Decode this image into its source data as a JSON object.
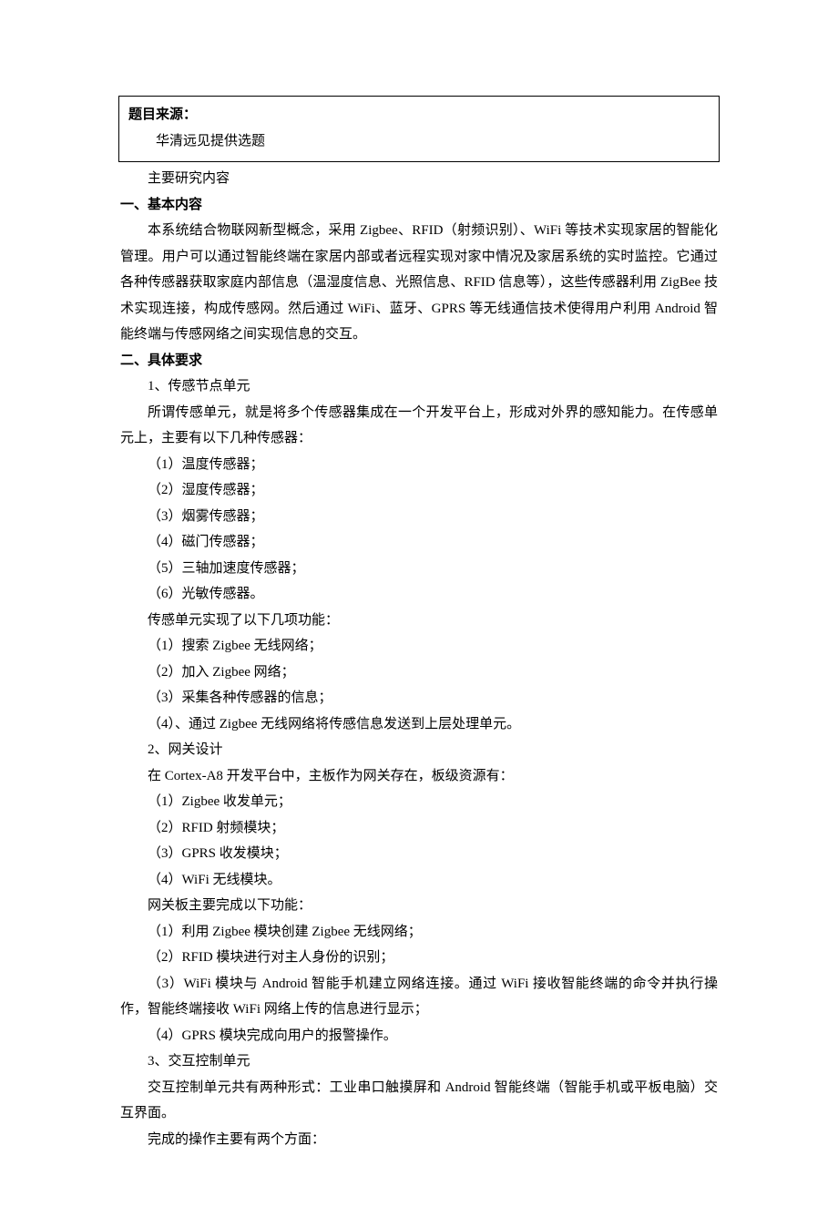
{
  "source_box": {
    "title": "题目来源：",
    "content": "华清远见提供选题"
  },
  "main_research_label": "主要研究内容",
  "section1": {
    "heading": "一、基本内容",
    "p1": "本系统结合物联网新型概念，采用 Zigbee、RFID（射频识别）、WiFi 等技术实现家居的智能化管理。用户可以通过智能终端在家居内部或者远程实现对家中情况及家居系统的实时监控。它通过各种传感器获取家庭内部信息（温湿度信息、光照信息、RFID 信息等），这些传感器利用 ZigBee 技术实现连接，构成传感网。然后通过 WiFi、蓝牙、GPRS 等无线通信技术使得用户利用 Android 智能终端与传感网络之间实现信息的交互。"
  },
  "section2": {
    "heading": "二、具体要求",
    "sub1_title": "1、传感节点单元",
    "sub1_p": "所谓传感单元，就是将多个传感器集成在一个开发平台上，形成对外界的感知能力。在传感单元上，主要有以下几种传感器：",
    "sensors": [
      "（1）温度传感器；",
      "（2）湿度传感器；",
      "（3）烟雾传感器；",
      "（4）磁门传感器；",
      "（5）三轴加速度传感器；",
      "（6）光敏传感器。"
    ],
    "sensor_funcs_label": "传感单元实现了以下几项功能：",
    "sensor_funcs": [
      "（1）搜索 Zigbee 无线网络；",
      "（2）加入 Zigbee 网络；",
      "（3）采集各种传感器的信息；",
      "（4）、通过 Zigbee 无线网络将传感信息发送到上层处理单元。"
    ],
    "sub2_title": "2、网关设计",
    "sub2_p": "在 Cortex-A8 开发平台中，主板作为网关存在，板级资源有：",
    "gw_res": [
      "（1）Zigbee 收发单元；",
      "（2）RFID 射频模块；",
      "（3）GPRS 收发模块；",
      "（4）WiFi 无线模块。"
    ],
    "gw_funcs_label": "网关板主要完成以下功能：",
    "gw_funcs": [
      "（1）利用 Zigbee 模块创建 Zigbee 无线网络；",
      "（2）RFID 模块进行对主人身份的识别；",
      "（3）WiFi 模块与 Android 智能手机建立网络连接。通过 WiFi 接收智能终端的命令并执行操作，智能终端接收 WiFi 网络上传的信息进行显示；",
      "（4）GPRS 模块完成向用户的报警操作。"
    ],
    "sub3_title": "3、交互控制单元",
    "sub3_p": "交互控制单元共有两种形式：工业串口触摸屏和 Android 智能终端（智能手机或平板电脑）交互界面。",
    "sub3_p2": "完成的操作主要有两个方面："
  }
}
